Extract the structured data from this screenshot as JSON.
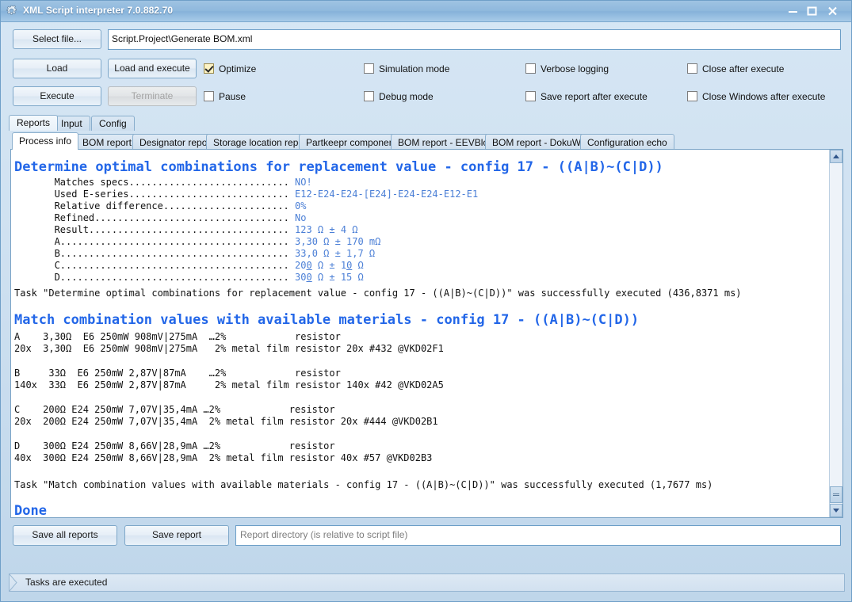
{
  "window": {
    "title": "XML Script interpreter 7.0.882.70",
    "icon": "gear-icon",
    "minimize_label": "–",
    "maximize_label": "□",
    "close_label": "×"
  },
  "toolbar": {
    "select_file_label": "Select file...",
    "load_label": "Load",
    "execute_label": "Execute",
    "load_and_execute_label": "Load and execute",
    "terminate_label": "Terminate",
    "file_path_value": "Script.Project\\Generate BOM.xml",
    "checkboxes": [
      {
        "name": "optimize",
        "label": "Optimize",
        "checked": true
      },
      {
        "name": "pause",
        "label": "Pause",
        "checked": false
      },
      {
        "name": "simulation-mode",
        "label": "Simulation mode",
        "checked": false
      },
      {
        "name": "debug-mode",
        "label": "Debug mode",
        "checked": false
      },
      {
        "name": "verbose-logging",
        "label": "Verbose logging",
        "checked": false
      },
      {
        "name": "save-report-after",
        "label": "Save report after execute",
        "checked": false
      },
      {
        "name": "close-after-execute",
        "label": "Close after execute",
        "checked": false
      },
      {
        "name": "close-windows-after",
        "label": "Close Windows after execute",
        "checked": false
      }
    ]
  },
  "outer_tabs": [
    {
      "label": "Reports",
      "active": true
    },
    {
      "label": "Input",
      "active": false
    },
    {
      "label": "Config",
      "active": false
    }
  ],
  "inner_tabs": [
    {
      "label": "Process info",
      "active": true
    },
    {
      "label": "BOM report",
      "active": false
    },
    {
      "label": "Designator report",
      "active": false
    },
    {
      "label": "Storage location report",
      "active": false
    },
    {
      "label": "Partkeepr components",
      "active": false
    },
    {
      "label": "BOM report - EEVBlog",
      "active": false
    },
    {
      "label": "BOM report - DokuWiki",
      "active": false
    },
    {
      "label": "Configuration echo",
      "active": false
    }
  ],
  "report": {
    "heading_1": "Determine optimal combinations for replacement value - config 17 - ((A|B)~(C|D))",
    "details": [
      {
        "label": "Matches specs",
        "dots": "............................",
        "value": "NO!"
      },
      {
        "label": "Used E-series",
        "dots": "............................",
        "value": "E12-E24-E24-[E24]-E24-E24-E12-E1"
      },
      {
        "label": "Relative difference",
        "dots": "......................",
        "value": "0%"
      },
      {
        "label": "Refined",
        "dots": "..................................",
        "value": "No"
      },
      {
        "label": "Result",
        "dots": "...................................",
        "value": "123 Ω ± 4 Ω"
      },
      {
        "label": "A",
        "dots": "........................................",
        "value": "3,30 Ω ± 170 mΩ"
      },
      {
        "label": "B",
        "dots": "........................................",
        "value": "33,0 Ω ± 1,7 Ω"
      },
      {
        "label": "C",
        "dots": "........................................",
        "value_pre": "20",
        "value_under": "0",
        "value_mid": " Ω ± 1",
        "value_under2": "0",
        "value_post": " Ω"
      },
      {
        "label": "D",
        "dots": "........................................",
        "value_pre": "30",
        "value_under": "0",
        "value_mid": " Ω ± 15 Ω",
        "value_under2": "",
        "value_post": ""
      }
    ],
    "task_1_result": "Task \"Determine optimal combinations for replacement value - config 17 - ((A|B)~(C|D))\" was successfully executed (436,8371 ms)",
    "heading_2": "Match combination values with available materials - config 17 - ((A|B)~(C|D))",
    "materials": [
      {
        "spec": "A    3,30Ω  E6 250mW 908mV|275mA  …2%            resistor",
        "match": "20x  3,30Ω  E6 250mW 908mV|275mA   2% metal film resistor 20x #432 @VKD02F1"
      },
      {
        "spec": "B     33Ω  E6 250mW 2,87V|87mA    …2%            resistor",
        "match": "140x  33Ω  E6 250mW 2,87V|87mA     2% metal film resistor 140x #42 @VKD02A5"
      },
      {
        "spec": "C    200Ω E24 250mW 7,07V|35,4mA …2%            resistor",
        "match": "20x  200Ω E24 250mW 7,07V|35,4mA  2% metal film resistor 20x #444 @VKD02B1"
      },
      {
        "spec": "D    300Ω E24 250mW 8,66V|28,9mA …2%            resistor",
        "match": "40x  300Ω E24 250mW 8,66V|28,9mA  2% metal film resistor 40x #57 @VKD02B3"
      }
    ],
    "task_2_result": "Task \"Match combination values with available materials - config 17 - ((A|B)~(C|D))\" was successfully executed (1,7677 ms)",
    "done_label": "Done"
  },
  "footer": {
    "save_all_reports_label": "Save all reports",
    "save_report_label": "Save report",
    "report_directory_placeholder": "Report directory (is relative to script file)",
    "report_directory_value": ""
  },
  "statusbar": {
    "text": "Tasks are executed"
  },
  "colors": {
    "accent_blue": "#2266e8",
    "value_blue": "#4b7fd6",
    "titlebar": "#8fb8dd",
    "checkbox_checked_bg": "#fdf3c4"
  }
}
